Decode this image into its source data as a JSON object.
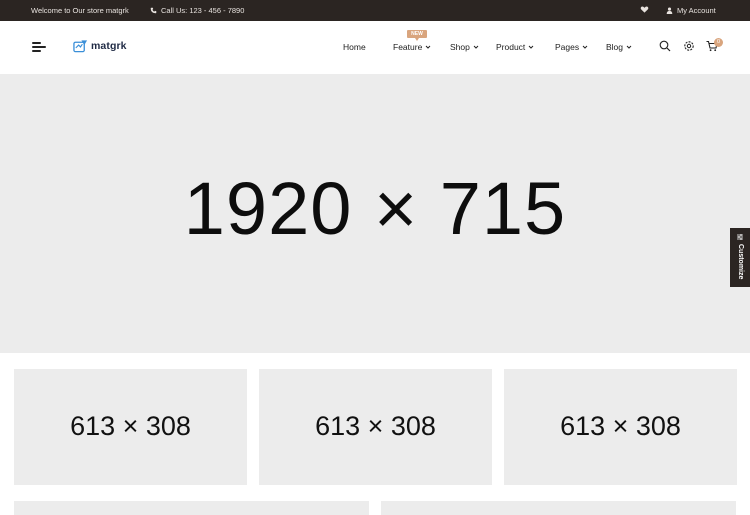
{
  "topbar": {
    "welcome": "Welcome to Our store matgrk",
    "call": "Call Us: 123 - 456 - 7890",
    "account": "My Account"
  },
  "logo": {
    "text": "matgrk"
  },
  "nav": {
    "badge": "NEW",
    "items": [
      {
        "label": "Home"
      },
      {
        "label": "Feature"
      },
      {
        "label": "Shop"
      },
      {
        "label": "Product"
      },
      {
        "label": "Pages"
      },
      {
        "label": "Blog"
      }
    ]
  },
  "cart": {
    "count": "0"
  },
  "hero": {
    "placeholder": "1920 × 715"
  },
  "customize": {
    "label": "Customize"
  },
  "banners": [
    {
      "placeholder": "613 × 308"
    },
    {
      "placeholder": "613 × 308"
    },
    {
      "placeholder": "613 × 308"
    }
  ],
  "colors": {
    "dark": "#2b2522",
    "accent": "#d9a57e",
    "placeholder_bg": "#ececec"
  }
}
